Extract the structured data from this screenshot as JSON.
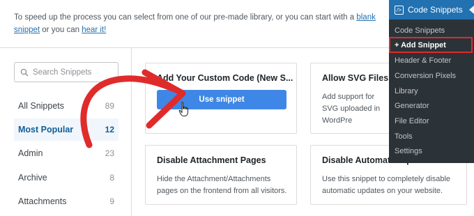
{
  "intro": {
    "text_before": "To speed up the process you can select from one of our pre-made library, or you can start with a ",
    "link1": "blank snippet",
    "text_mid": " or you can ",
    "link2": "hear it!"
  },
  "search": {
    "placeholder": "Search Snippets"
  },
  "categories": [
    {
      "label": "All Snippets",
      "count": "89"
    },
    {
      "label": "Most Popular",
      "count": "12"
    },
    {
      "label": "Admin",
      "count": "23"
    },
    {
      "label": "Archive",
      "count": "8"
    },
    {
      "label": "Attachments",
      "count": "9"
    }
  ],
  "cards": [
    {
      "title": "Add Your Custom Code (New S...",
      "button": "Use snippet"
    },
    {
      "title": "Allow SVG Files U",
      "desc": "Add support for SVG uploaded in WordPre"
    },
    {
      "title": "Disable Attachment Pages",
      "desc": "Hide the Attachment/Attachments pages on the frontend from all visitors."
    },
    {
      "title": "Disable Automatic Updates",
      "desc": "Use this snippet to completely disable automatic updates on your website."
    }
  ],
  "menu": {
    "title": "Code Snippets",
    "logo": "/>",
    "items": [
      "Code Snippets",
      "+ Add Snippet",
      "Header & Footer",
      "Conversion Pixels",
      "Library",
      "Generator",
      "File Editor",
      "Tools",
      "Settings"
    ]
  },
  "colors": {
    "accent": "#3f87e6",
    "annotation": "#e02b2b",
    "menu_bg": "#2c3338",
    "menu_head": "#2271b1"
  },
  "icons": [
    "search-icon",
    "code-snippets-logo-icon",
    "hand-pointer-icon",
    "red-arrow-annotation"
  ]
}
